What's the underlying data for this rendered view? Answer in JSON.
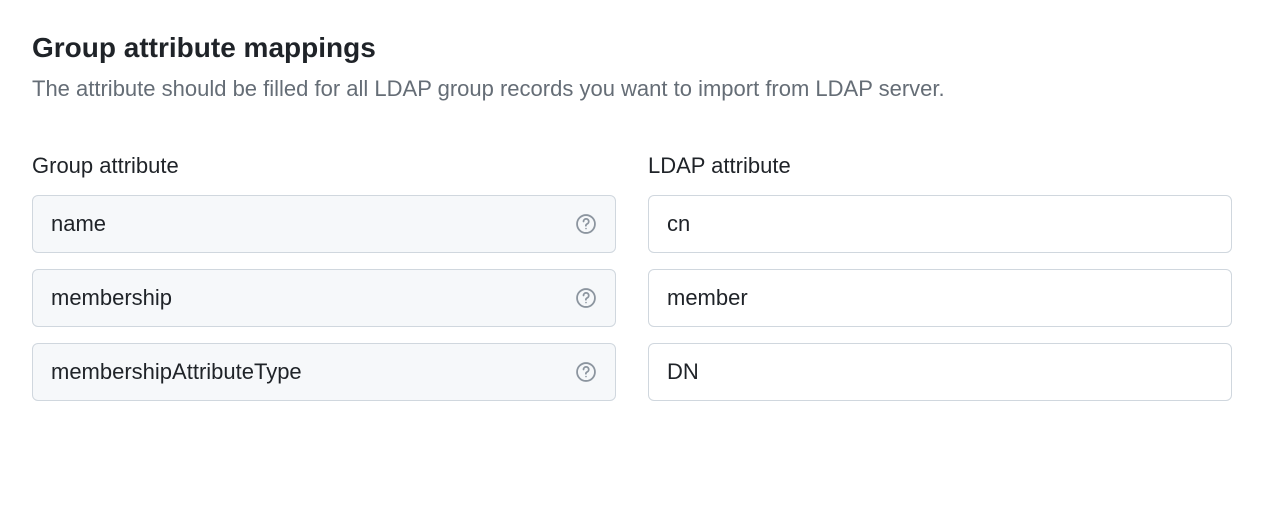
{
  "section": {
    "title": "Group attribute mappings",
    "description": "The attribute should be filled for all LDAP group records you want to import from LDAP server."
  },
  "headers": {
    "group_attribute": "Group attribute",
    "ldap_attribute": "LDAP attribute"
  },
  "rows": [
    {
      "group_attr": "name",
      "ldap_attr": "cn"
    },
    {
      "group_attr": "membership",
      "ldap_attr": "member"
    },
    {
      "group_attr": "membershipAttributeType",
      "ldap_attr": "DN"
    }
  ]
}
